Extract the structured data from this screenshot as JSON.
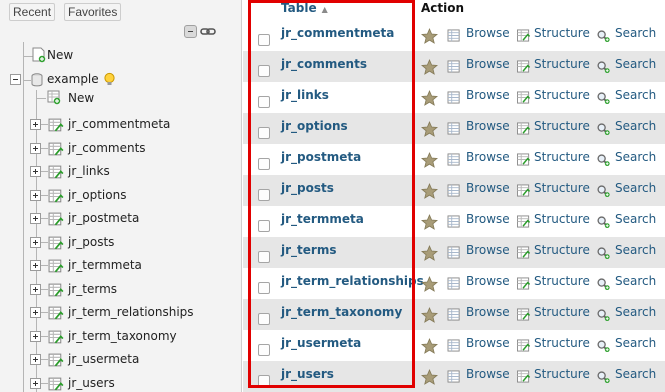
{
  "nav": {
    "recent_label": "Recent",
    "favorites_label": "Favorites",
    "new_label": "New",
    "database": "example",
    "db_new_label": "New",
    "tables": [
      "jr_commentmeta",
      "jr_comments",
      "jr_links",
      "jr_options",
      "jr_postmeta",
      "jr_posts",
      "jr_termmeta",
      "jr_terms",
      "jr_term_relationships",
      "jr_term_taxonomy",
      "jr_usermeta",
      "jr_users"
    ]
  },
  "main": {
    "header_table": "Table",
    "header_action": "Action",
    "sort_glyph": "▲",
    "rows": [
      {
        "name": "jr_commentmeta"
      },
      {
        "name": "jr_comments"
      },
      {
        "name": "jr_links"
      },
      {
        "name": "jr_options"
      },
      {
        "name": "jr_postmeta"
      },
      {
        "name": "jr_posts"
      },
      {
        "name": "jr_termmeta"
      },
      {
        "name": "jr_terms"
      },
      {
        "name": "jr_term_relationships"
      },
      {
        "name": "jr_term_taxonomy"
      },
      {
        "name": "jr_usermeta"
      },
      {
        "name": "jr_users"
      }
    ],
    "actions": {
      "browse": "Browse",
      "structure": "Structure",
      "search": "Search"
    }
  },
  "icons": {
    "favorite": "star-icon",
    "browse": "browse-icon",
    "structure": "structure-icon",
    "search": "search-icon",
    "table": "table-icon"
  },
  "colors": {
    "link": "#235a81",
    "highlight": "#e10000",
    "row_alt": "#e6e6e6",
    "nav_bg": "#f3f3f3"
  }
}
